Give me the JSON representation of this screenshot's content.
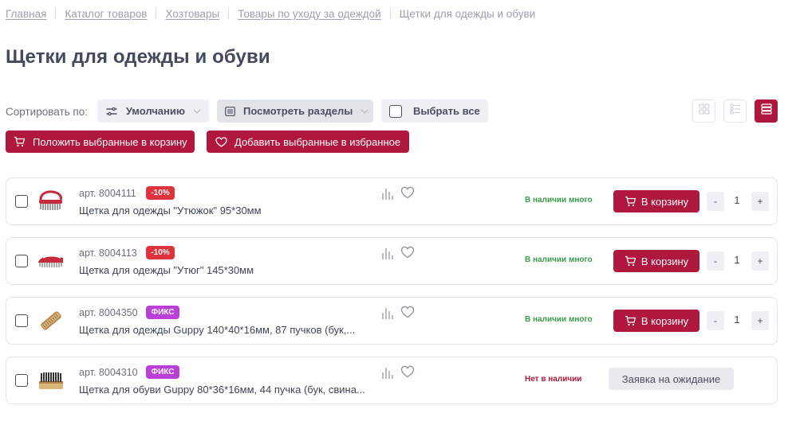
{
  "breadcrumbs": [
    "Главная",
    "Каталог товаров",
    "Хозтовары",
    "Товары по уходу за одеждой",
    "Щетки для одежды и обуви"
  ],
  "page_title": "Щетки для одежды и обуви",
  "toolbar": {
    "sort_label": "Сортировать по:",
    "sort_value": "Умолчанию",
    "sections_label": "Посмотреть разделы",
    "select_all_label": "Выбрать все",
    "add_selected_to_cart": "Положить выбранные в корзину",
    "add_selected_to_favorites": "Добавить выбранные в избранное"
  },
  "products": [
    {
      "article": "арт. 8004111",
      "badge": "-10%",
      "badge_type": "discount",
      "name": "Щетка для одежды \"Утюжок\" 95*30мм",
      "availability": "В наличии много",
      "in_stock": true,
      "cart_label": "В корзину",
      "qty": "1",
      "minus": "-",
      "plus": "+"
    },
    {
      "article": "арт. 8004113",
      "badge": "-10%",
      "badge_type": "discount",
      "name": "Щетка для одежды \"Утюг\" 145*30мм",
      "availability": "В наличии много",
      "in_stock": true,
      "cart_label": "В корзину",
      "qty": "1",
      "minus": "-",
      "plus": "+"
    },
    {
      "article": "арт. 8004350",
      "badge": "ФИКС",
      "badge_type": "fix",
      "name": "Щетка для одежды Guppy 140*40*16мм, 87 пучков (бук,...",
      "availability": "В наличии много",
      "in_stock": true,
      "cart_label": "В корзину",
      "qty": "1",
      "minus": "-",
      "plus": "+"
    },
    {
      "article": "арт. 8004310",
      "badge": "ФИКС",
      "badge_type": "fix",
      "name": "Щетка для обуви Guppy 80*36*16мм, 44 пучка (бук, свина...",
      "availability": "Нет в наличии",
      "in_stock": false,
      "wait_label": "Заявка на ожидание"
    }
  ],
  "colors": {
    "accent": "#b0173c",
    "discount": "#e0323c",
    "fix": "#b93fd6",
    "in_stock": "#3a9a4a",
    "text": "#3a3f51"
  },
  "icons": [
    "filter-sort-icon",
    "list-icon",
    "chevron-down-icon",
    "grid-view-icon",
    "list-view-icon",
    "rows-view-icon",
    "cart-icon",
    "heart-icon",
    "stats-icon"
  ]
}
